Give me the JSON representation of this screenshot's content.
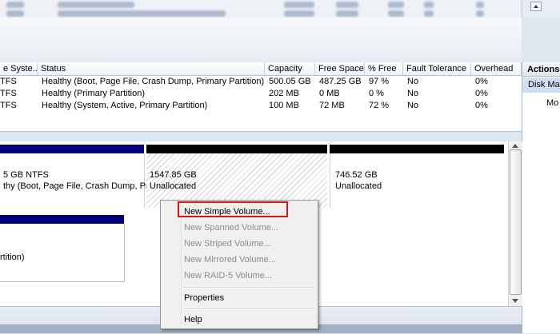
{
  "volume_list": {
    "columns": [
      "e Syste...",
      "Status",
      "Capacity",
      "Free Space",
      "% Free",
      "Fault Tolerance",
      "Overhead"
    ],
    "rows": [
      [
        "TFS",
        "Healthy (Boot, Page File, Crash Dump, Primary Partition)",
        "500.05 GB",
        "487.25 GB",
        "97 %",
        "No",
        "0%"
      ],
      [
        "TFS",
        "Healthy (Primary Partition)",
        "202 MB",
        "0 MB",
        "0 %",
        "No",
        "0%"
      ],
      [
        "TFS",
        "Healthy (System, Active, Primary Partition)",
        "100 MB",
        "72 MB",
        "72 %",
        "No",
        "0%"
      ]
    ]
  },
  "actions": {
    "header": "Actions",
    "selected": "Disk Ma",
    "more": "Mo"
  },
  "disk_partitions": {
    "p1_size": "5 GB NTFS",
    "p1_status": "thy (Boot, Page File, Crash Dump, Pr",
    "p2_size": "1547.85 GB",
    "p2_status": "Unallocated",
    "p3_size": "746.52 GB",
    "p3_status": "Unallocated",
    "p4_status": "rtition)"
  },
  "context_menu": {
    "new_simple_volume": "New Simple Volume...",
    "new_spanned_volume": "New Spanned Volume...",
    "new_striped_volume": "New Striped Volume...",
    "new_mirrored_volume": "New Mirrored Volume...",
    "new_raid5_volume": "New RAID-5 Volume...",
    "properties": "Properties",
    "help": "Help"
  },
  "colors": {
    "primary_bar": "#00007f",
    "unallocated_bar": "#000000",
    "highlight_border": "#d81616"
  }
}
